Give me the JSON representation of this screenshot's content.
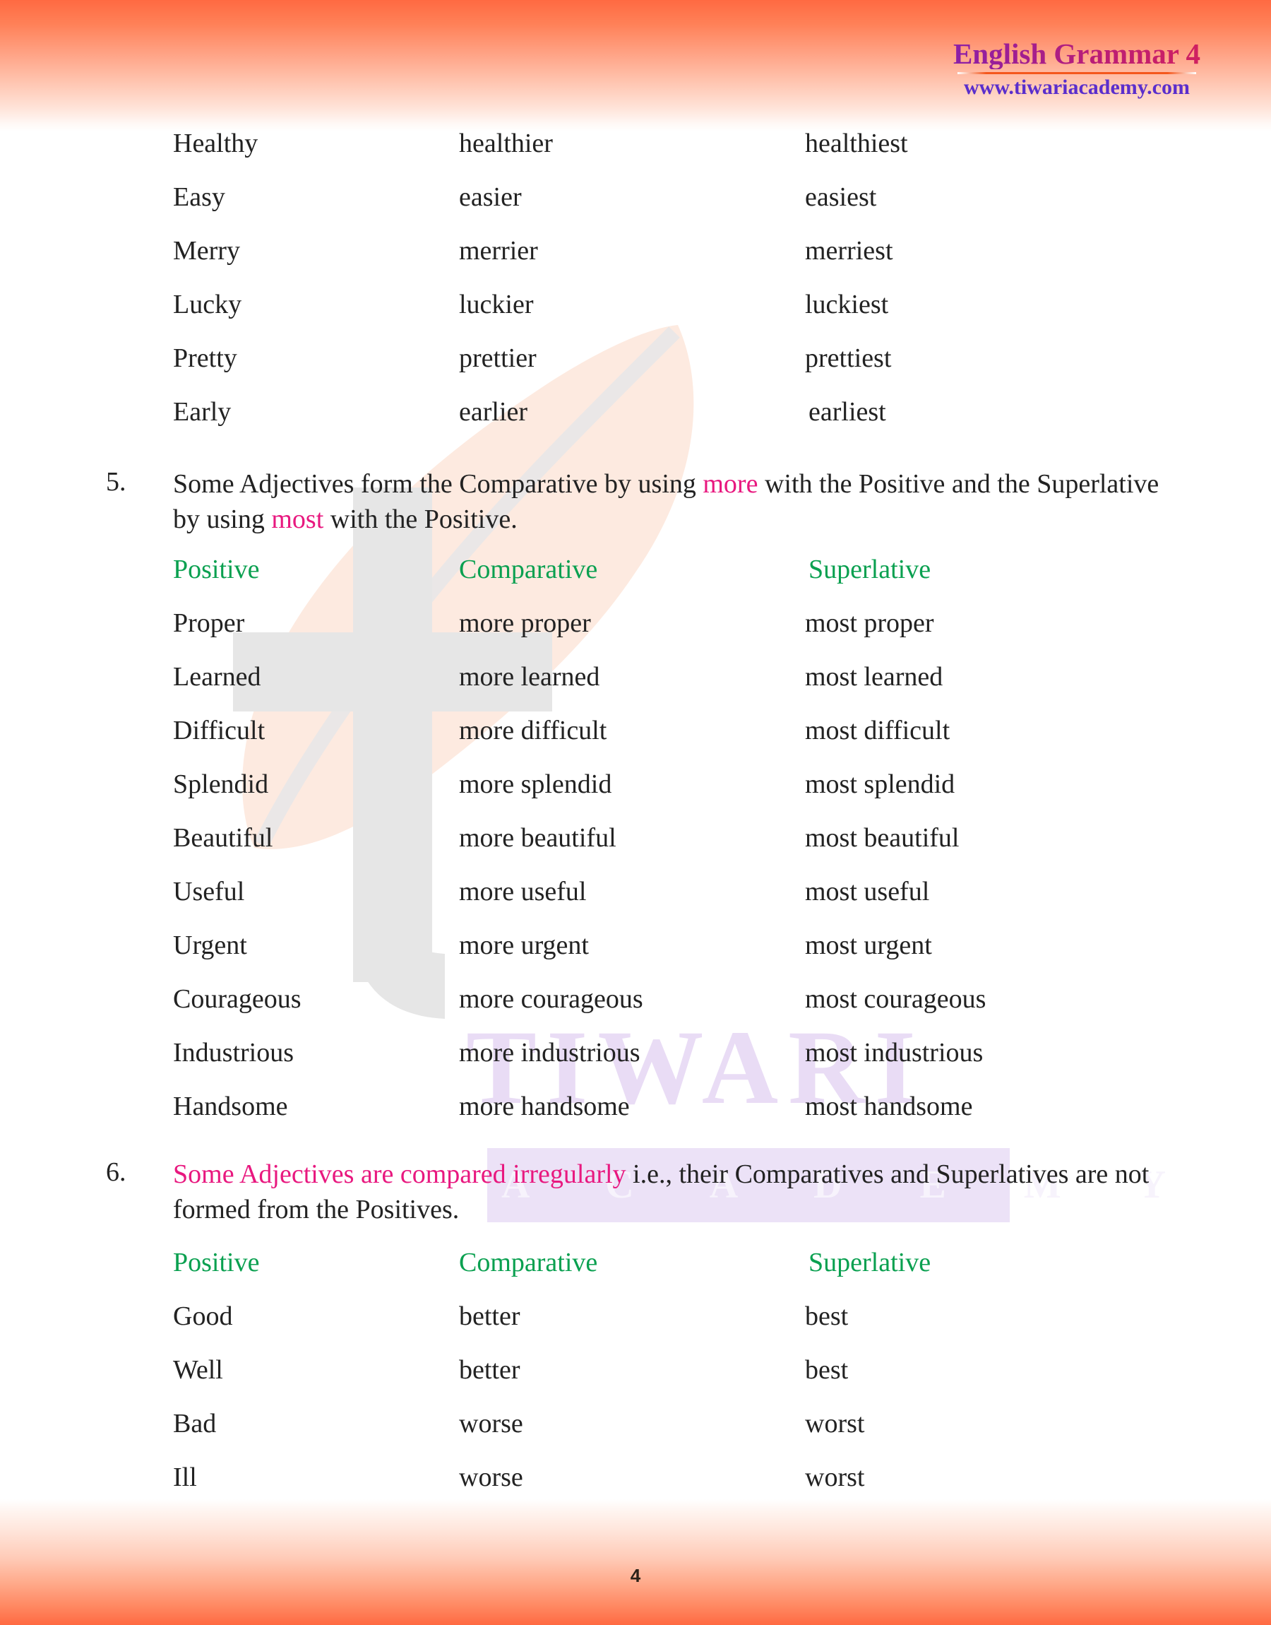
{
  "header": {
    "title": "English Grammar 4",
    "url": "www.tiwariacademy.com"
  },
  "watermark": {
    "primary": "TIWARI",
    "secondary": "A C A D E M Y",
    "letter": "t"
  },
  "colors": {
    "accent_orange": "#ff6a42",
    "heading_green": "#0aa050",
    "highlight_pink": "#e8187f",
    "title_purple": "#a01e8c",
    "url_blue": "#5a2ecc",
    "body_text": "#222222",
    "watermark_purple": "#e9dcf5"
  },
  "top_table": {
    "rows": [
      {
        "positive": "Healthy",
        "comparative": "healthier",
        "superlative": "healthiest"
      },
      {
        "positive": "Easy",
        "comparative": "easier",
        "superlative": "easiest"
      },
      {
        "positive": "Merry",
        "comparative": "merrier",
        "superlative": "merriest"
      },
      {
        "positive": "Lucky",
        "comparative": "luckier",
        "superlative": "luckiest"
      },
      {
        "positive": "Pretty",
        "comparative": "prettier",
        "superlative": "prettiest"
      },
      {
        "positive": "Early",
        "comparative": "earlier",
        "superlative": "earliest"
      }
    ]
  },
  "point5": {
    "number": "5.",
    "line1_before": "Some Adjectives form the Comparative by using ",
    "line1_highlight": "more",
    "line1_after": " with the Positive",
    "line2_before": "and the Superlative by using ",
    "line2_highlight": "most",
    "line2_after": " with the Positive."
  },
  "table5": {
    "headers": {
      "positive": "Positive",
      "comparative": "Comparative",
      "superlative": "Superlative"
    },
    "rows": [
      {
        "positive": "Proper",
        "comparative": "more proper",
        "superlative": "most proper"
      },
      {
        "positive": "Learned",
        "comparative": "more learned",
        "superlative": "most learned"
      },
      {
        "positive": "Difficult",
        "comparative": "more difficult",
        "superlative": "most difficult"
      },
      {
        "positive": "Splendid",
        "comparative": "more splendid",
        "superlative": "most splendid"
      },
      {
        "positive": "Beautiful",
        "comparative": "more beautiful",
        "superlative": "most beautiful"
      },
      {
        "positive": "Useful",
        "comparative": "more useful",
        "superlative": "most useful"
      },
      {
        "positive": "Urgent",
        "comparative": "more urgent",
        "superlative": "most urgent"
      },
      {
        "positive": "Courageous",
        "comparative": "more courageous",
        "superlative": "most courageous"
      },
      {
        "positive": "Industrious",
        "comparative": "more industrious",
        "superlative": "most industrious"
      },
      {
        "positive": "Handsome",
        "comparative": "more handsome",
        "superlative": "most handsome"
      }
    ]
  },
  "point6": {
    "number": "6.",
    "line1_highlight": "Some Adjectives are compared irregularly",
    "line1_after": " i.e., their Comparatives and",
    "line2": "Superlatives are not formed from the Positives."
  },
  "table6": {
    "headers": {
      "positive": "Positive",
      "comparative": "Comparative",
      "superlative": "Superlative"
    },
    "rows": [
      {
        "positive": "Good",
        "comparative": "better",
        "superlative": "best"
      },
      {
        "positive": "Well",
        "comparative": "better",
        "superlative": "best"
      },
      {
        "positive": "Bad",
        "comparative": "worse",
        "superlative": "worst"
      },
      {
        "positive": "Ill",
        "comparative": "worse",
        "superlative": "worst"
      }
    ]
  },
  "footer": {
    "page_number": "4"
  }
}
